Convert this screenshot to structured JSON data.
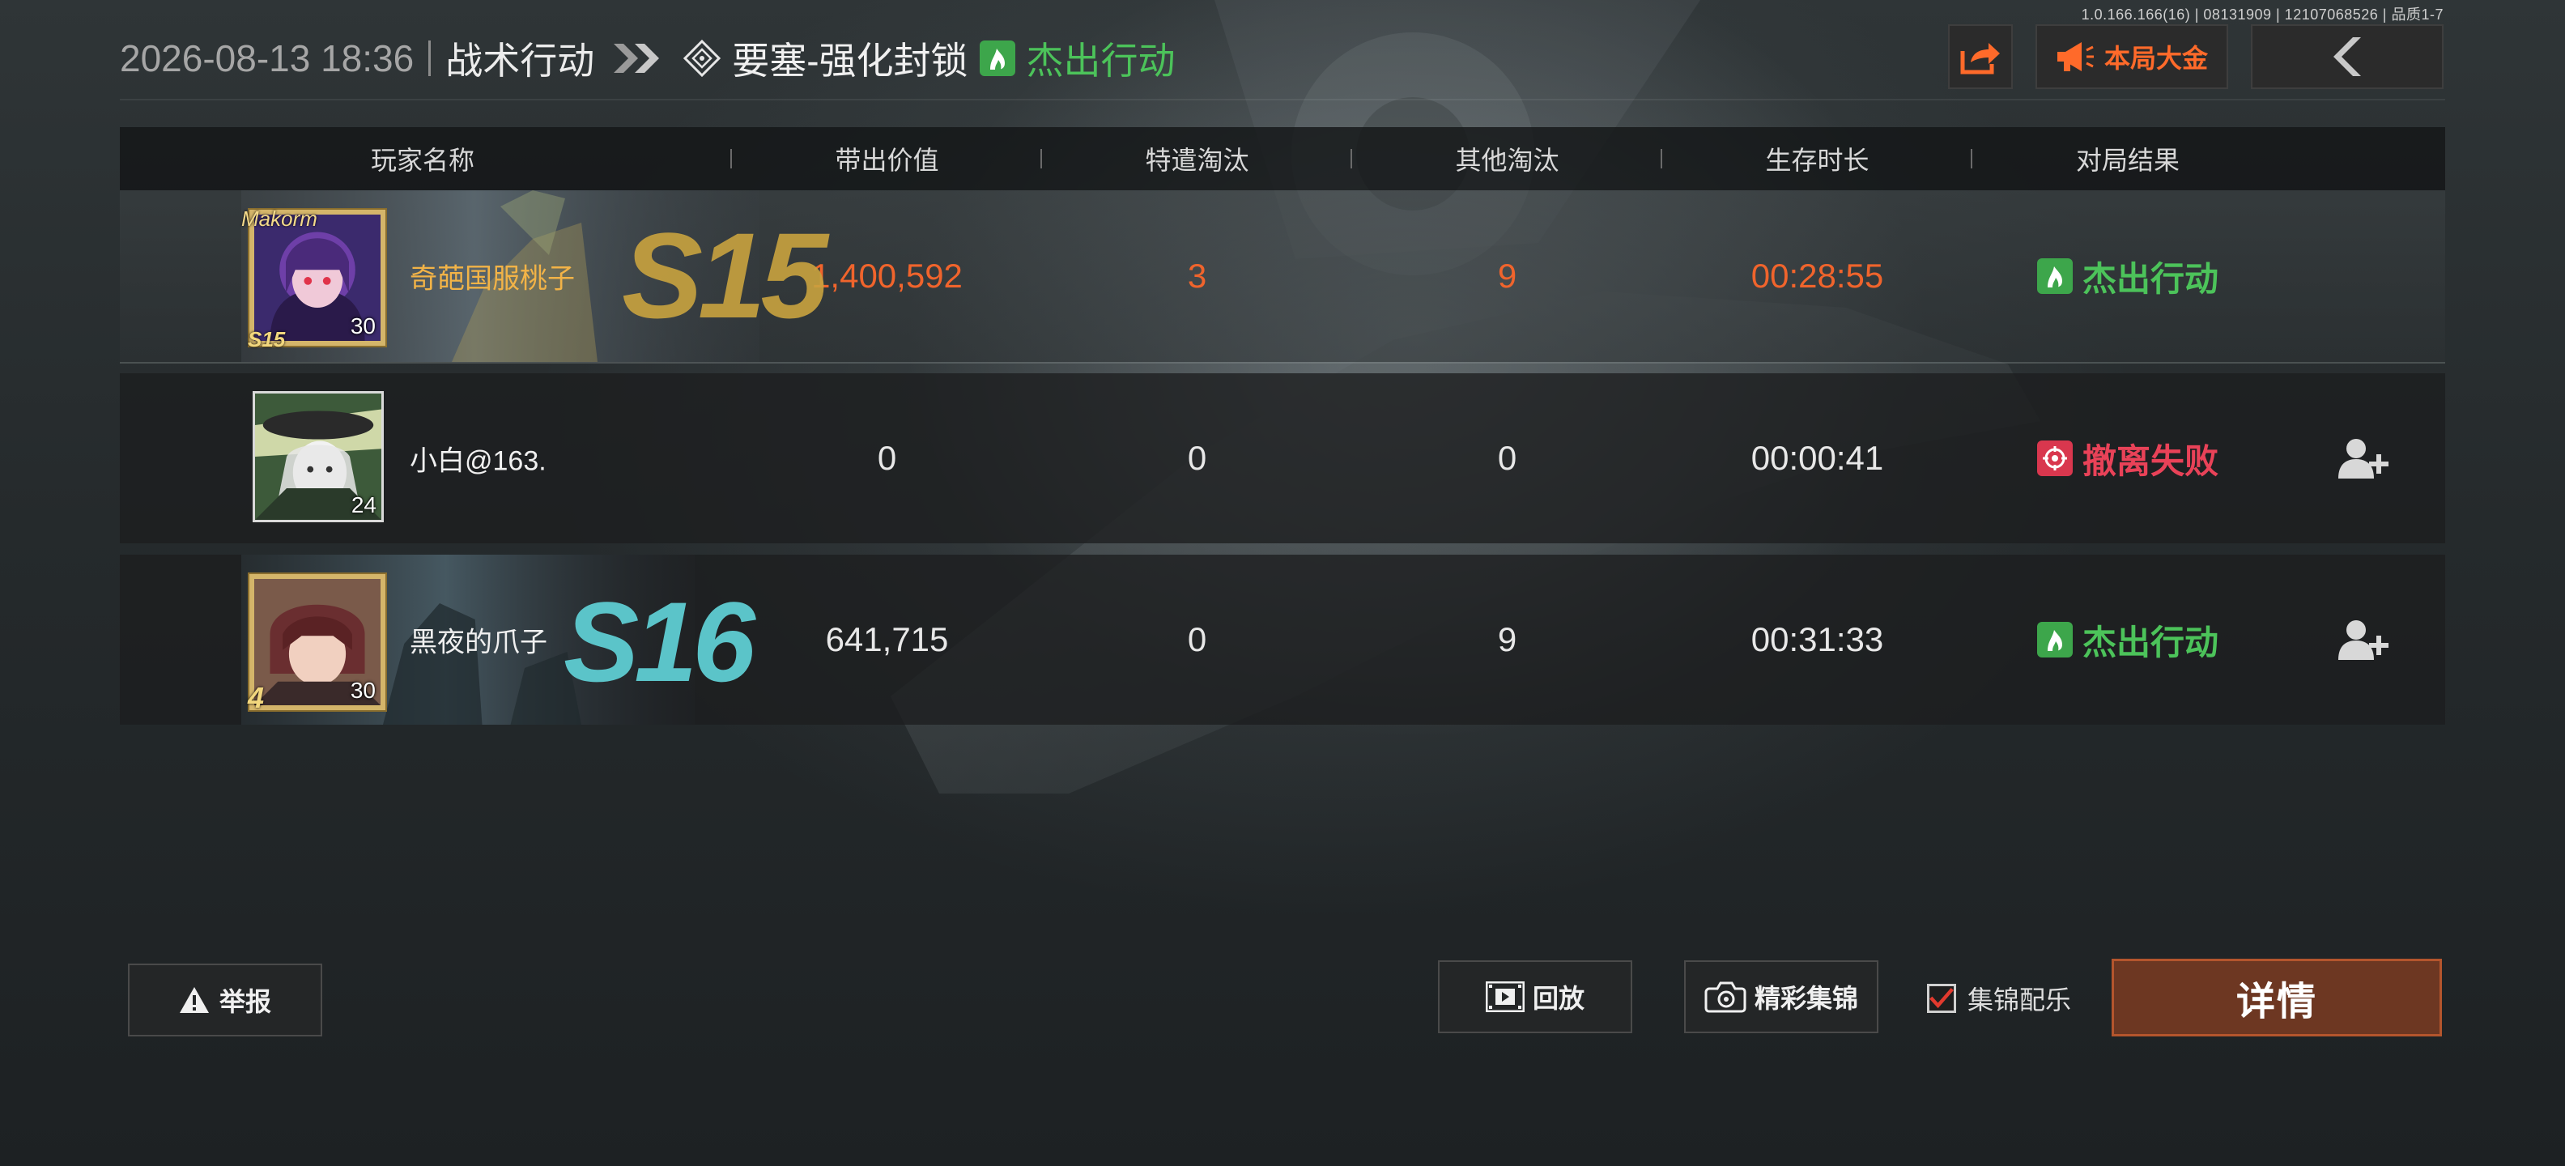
{
  "version_info": "1.0.166.166(16) | 08131909 | 12107068526 | 品质1-7",
  "header": {
    "datetime": "2026-08-13 18:36",
    "mode": "战术行动",
    "map": "要塞-强化封锁",
    "result": "杰出行动"
  },
  "top_buttons": {
    "share_icon": "share-icon",
    "jackpot_label": "本局大金",
    "back_icon": "chevron-left-icon"
  },
  "table": {
    "columns": [
      "玩家名称",
      "带出价值",
      "特遣淘汰",
      "其他淘汰",
      "生存时长",
      "对局结果"
    ],
    "rows": [
      {
        "name": "奇葩国服桃子",
        "level": "30",
        "frame_tag": "Makorm",
        "frame_season": "S15",
        "season_banner": "S15",
        "value": "1,400,592",
        "task_kills": "3",
        "other_kills": "9",
        "survival": "00:28:55",
        "result": "杰出行动",
        "result_type": "success",
        "highlight": true
      },
      {
        "name": "小白@163.",
        "level": "24",
        "value": "0",
        "task_kills": "0",
        "other_kills": "0",
        "survival": "00:00:41",
        "result": "撤离失败",
        "result_type": "fail",
        "add_friend": true
      },
      {
        "name": "黑夜的爪子",
        "level": "30",
        "frame_season": "4",
        "season_banner": "S16",
        "value": "641,715",
        "task_kills": "0",
        "other_kills": "9",
        "survival": "00:31:33",
        "result": "杰出行动",
        "result_type": "success",
        "add_friend": true
      }
    ]
  },
  "bottom": {
    "report_label": "举报",
    "replay_label": "回放",
    "highlights_label": "精彩集锦",
    "music_label": "集锦配乐",
    "music_checked": true,
    "details_label": "详情"
  },
  "colors": {
    "success": "#4cc35a",
    "fail": "#e94258",
    "highlight_value": "#f0642c",
    "jackpot": "#ff6a2a",
    "details_bg": "#6d3722"
  }
}
